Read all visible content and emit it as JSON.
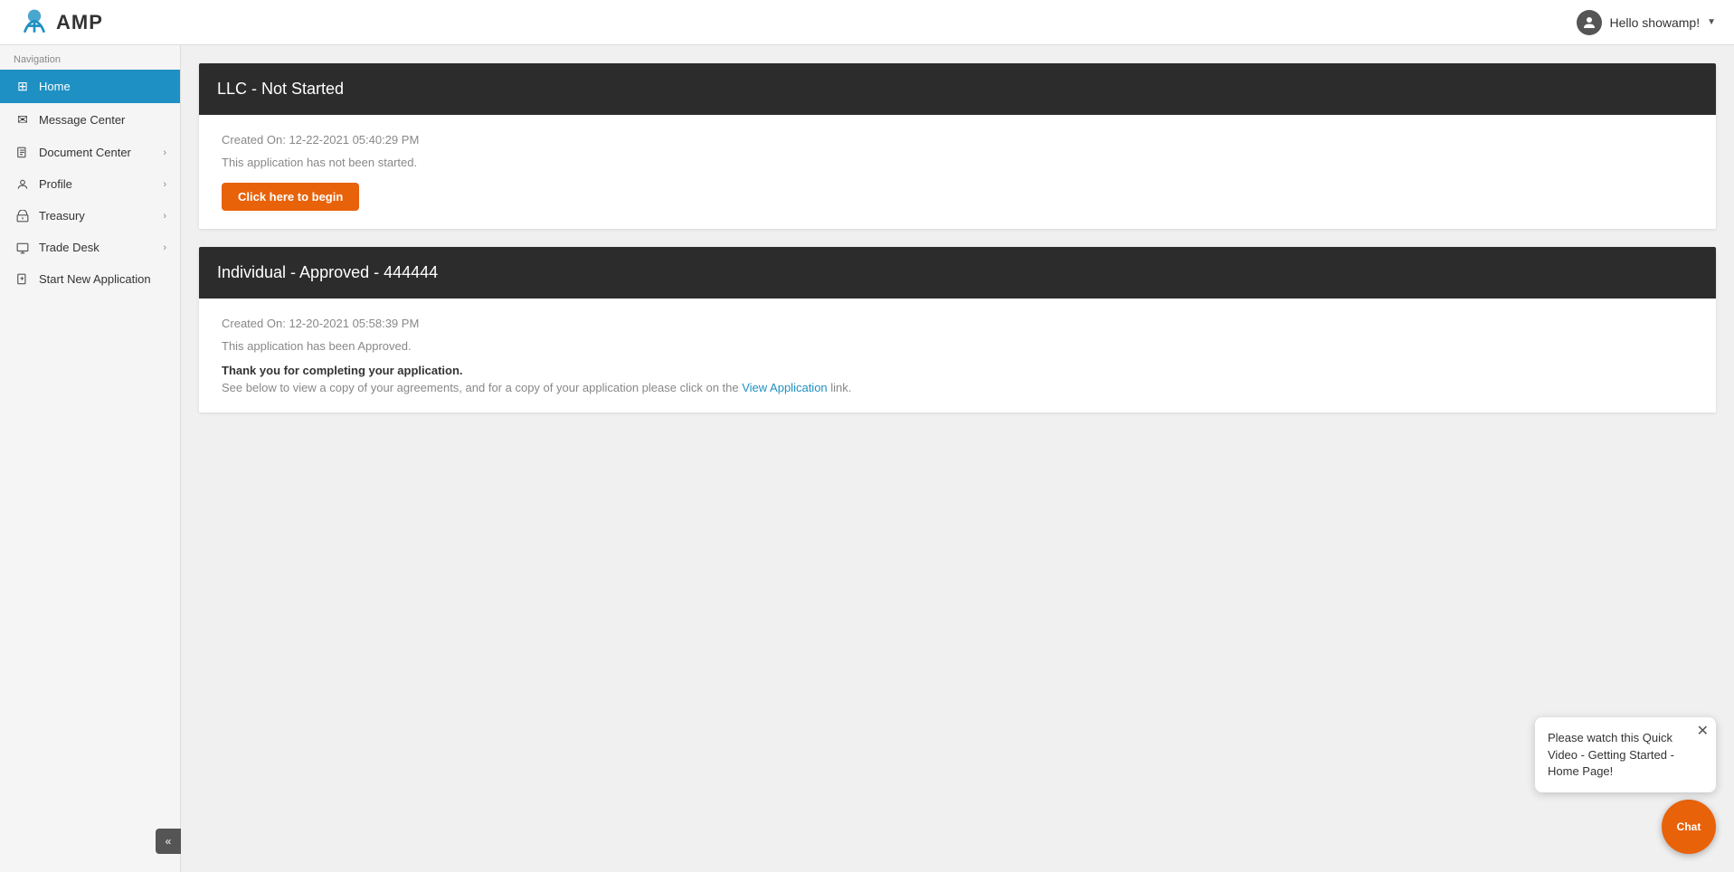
{
  "header": {
    "logo_text": "AMP",
    "user_greeting": "Hello showamp!",
    "dropdown_arrow": "▼"
  },
  "sidebar": {
    "nav_label": "Navigation",
    "items": [
      {
        "id": "home",
        "label": "Home",
        "icon": "⊞",
        "active": true,
        "has_chevron": false
      },
      {
        "id": "message-center",
        "label": "Message Center",
        "icon": "✉",
        "active": false,
        "has_chevron": false
      },
      {
        "id": "document-center",
        "label": "Document Center",
        "icon": "📄",
        "active": false,
        "has_chevron": true
      },
      {
        "id": "profile",
        "label": "Profile",
        "icon": "👤",
        "active": false,
        "has_chevron": true
      },
      {
        "id": "treasury",
        "label": "Treasury",
        "icon": "🏛",
        "active": false,
        "has_chevron": true
      },
      {
        "id": "trade-desk",
        "label": "Trade Desk",
        "icon": "🖥",
        "active": false,
        "has_chevron": true
      },
      {
        "id": "start-new-application",
        "label": "Start New Application",
        "icon": "📋",
        "active": false,
        "has_chevron": false
      }
    ],
    "collapse_icon": "«"
  },
  "main": {
    "applications": [
      {
        "id": "llc-not-started",
        "title": "LLC - Not Started",
        "created_label": "Created On:",
        "created_date": "12-22-2021 05:40:29 PM",
        "status_text": "This application has not been started.",
        "button_label": "Click here to begin",
        "show_button": true,
        "show_approved": false
      },
      {
        "id": "individual-approved",
        "title": "Individual - Approved - 444444",
        "created_label": "Created On:",
        "created_date": "12-20-2021 05:58:39 PM",
        "approved_text": "This application has been Approved.",
        "thank_you_text": "Thank you for completing your application.",
        "agreement_text_before": "See below to view a copy of your agreements, and for a copy of your application please click on the ",
        "agreement_link_text": "View Application",
        "agreement_text_after": " link.",
        "show_button": false,
        "show_approved": true
      }
    ]
  },
  "chat": {
    "bubble_text": "Please watch this Quick Video - Getting Started - Home Page!",
    "button_label": "Chat",
    "close_icon": "✕"
  }
}
